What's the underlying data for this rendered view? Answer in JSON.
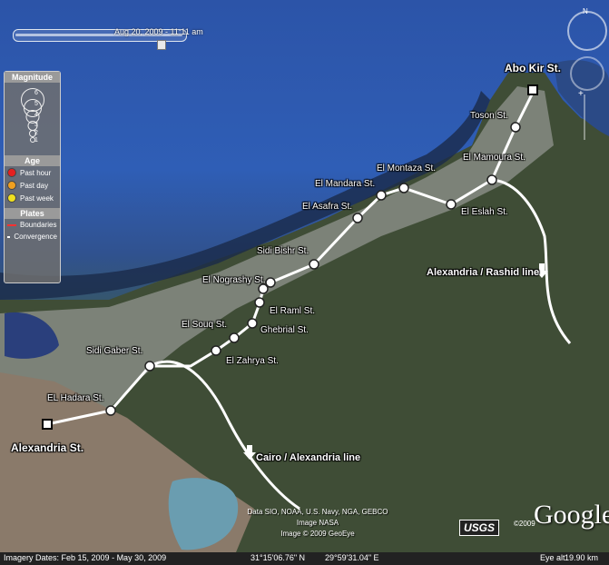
{
  "timeline": {
    "date": "Aug 20, 2009 - 11:11 am",
    "position": 0.86
  },
  "legend": {
    "magnitude_title": "Magnitude",
    "magnitude_levels": [
      "6",
      "5",
      "4",
      "3",
      "2",
      "1"
    ],
    "age_title": "Age",
    "age_items": [
      {
        "label": "Past hour",
        "color": "#e52020"
      },
      {
        "label": "Past day",
        "color": "#f0a020"
      },
      {
        "label": "Past week",
        "color": "#f0e020"
      }
    ],
    "plates_title": "Plates",
    "plates_items": [
      {
        "label": "Boundaries",
        "color": "#ff3030"
      },
      {
        "label": "Convergence",
        "color": "#ffffff"
      }
    ]
  },
  "map": {
    "terminals": [
      "Abo Kir St.",
      "Alexandria St."
    ],
    "stations": [
      "Toson St.",
      "El Mamoura St.",
      "El Montaza St.",
      "El Mandara St.",
      "El Eslah St.",
      "El Asafra St.",
      "Sidi Bishr St.",
      "El Nograshy St.",
      "El Raml St.",
      "Ghebrial St.",
      "El Souq St.",
      "El Zahrya St.",
      "Sidi Gaber St.",
      "EL Hadara St."
    ],
    "lines": [
      "Alexandria / Rashid line",
      "Cairo / Alexandria line"
    ]
  },
  "credits": {
    "line1": "Data SIO, NOAA, U.S. Navy, NGA, GEBCO",
    "line2": "Image NASA",
    "line3": "Image © 2009 GeoEye",
    "usgs": "USGS",
    "copyright": "©2009",
    "google": "Google"
  },
  "status": {
    "imagery_dates": "Imagery Dates: Feb 15, 2009 - May 30, 2009",
    "lat": "31°15'06.76\" N",
    "lon": "29°59'31.04\" E",
    "eye_alt_label": "Eye alt",
    "eye_alt": "19.90 km"
  }
}
